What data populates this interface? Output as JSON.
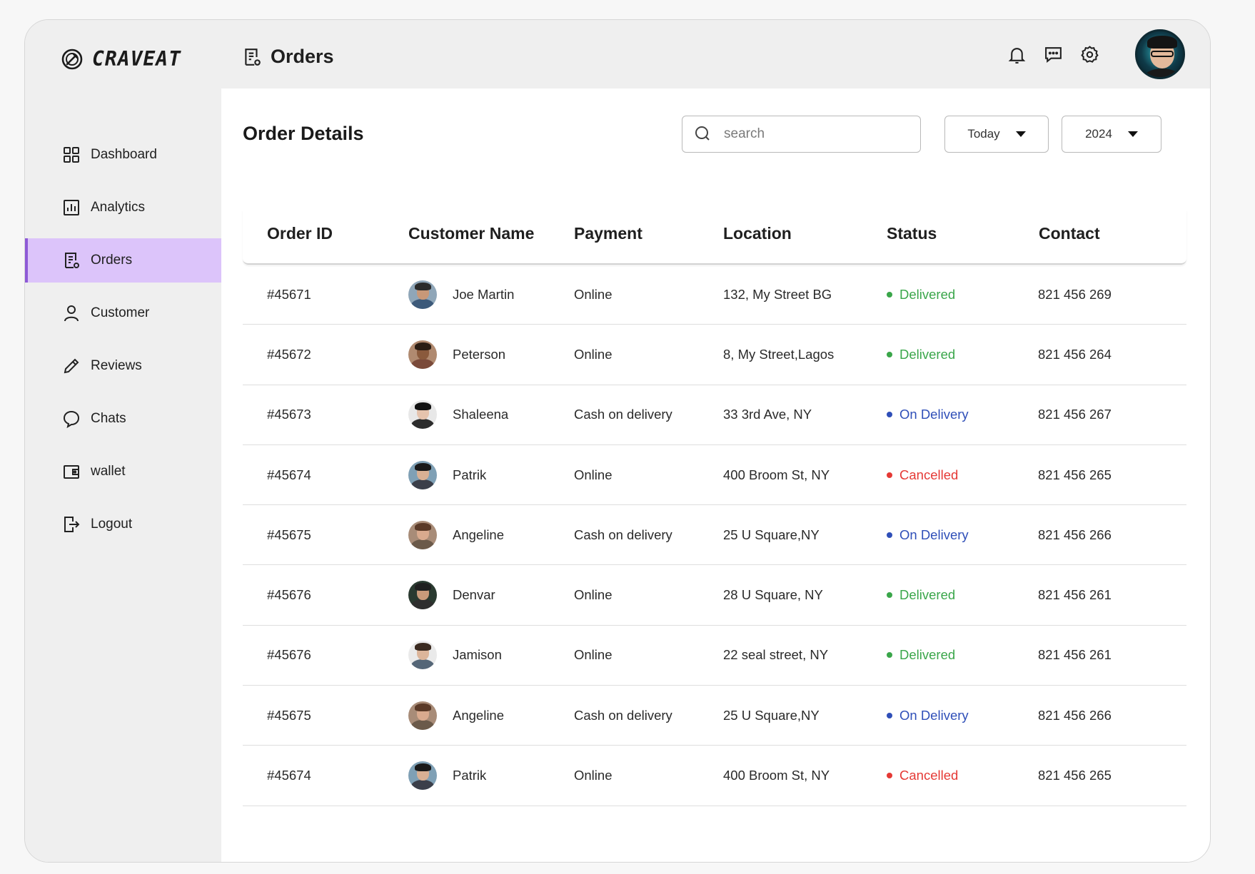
{
  "app": {
    "logo_text": "CRAVEAT"
  },
  "sidebar": {
    "items": [
      {
        "label": "Dashboard",
        "icon": "dashboard-icon"
      },
      {
        "label": "Analytics",
        "icon": "analytics-icon"
      },
      {
        "label": "Orders",
        "icon": "orders-icon",
        "active": true
      },
      {
        "label": "Customer",
        "icon": "customer-icon"
      },
      {
        "label": "Reviews",
        "icon": "pencil-icon"
      },
      {
        "label": "Chats",
        "icon": "chat-bubble-icon"
      },
      {
        "label": "wallet",
        "icon": "wallet-icon"
      },
      {
        "label": "Logout",
        "icon": "logout-icon"
      }
    ]
  },
  "header": {
    "title": "Orders",
    "icons": [
      "bell-icon",
      "message-icon",
      "settings-gear-icon"
    ]
  },
  "main": {
    "section_title": "Order Details",
    "search_placeholder": "search",
    "filter_period": "Today",
    "filter_year": "2024"
  },
  "table": {
    "columns": {
      "id": "Order ID",
      "name": "Customer Name",
      "payment": "Payment",
      "location": "Location",
      "status": "Status",
      "contact": "Contact"
    },
    "rows": [
      {
        "id": "#45671",
        "name": "Joe Martin",
        "payment": "Online",
        "location": "132, My Street BG",
        "status": "Delivered",
        "contact": "821 456 269"
      },
      {
        "id": "#45672",
        "name": "Peterson",
        "payment": "Online",
        "location": "8, My Street,Lagos",
        "status": "Delivered",
        "contact": "821 456 264"
      },
      {
        "id": "#45673",
        "name": "Shaleena",
        "payment": "Cash on delivery",
        "location": "33 3rd Ave, NY",
        "status": "On Delivery",
        "contact": "821 456 267"
      },
      {
        "id": "#45674",
        "name": "Patrik",
        "payment": "Online",
        "location": "400 Broom St, NY",
        "status": "Cancelled",
        "contact": "821 456 265"
      },
      {
        "id": "#45675",
        "name": "Angeline",
        "payment": "Cash on delivery",
        "location": "25 U Square,NY",
        "status": "On Delivery",
        "contact": "821 456 266"
      },
      {
        "id": "#45676",
        "name": "Denvar",
        "payment": "Online",
        "location": "28 U Square, NY",
        "status": "Delivered",
        "contact": "821 456 261"
      },
      {
        "id": "#45676",
        "name": "Jamison",
        "payment": "Online",
        "location": "22 seal street, NY",
        "status": "Delivered",
        "contact": "821 456 261"
      },
      {
        "id": "#45675",
        "name": "Angeline",
        "payment": "Cash on delivery",
        "location": "25 U Square,NY",
        "status": "On Delivery",
        "contact": "821 456 266"
      },
      {
        "id": "#45674",
        "name": "Patrik",
        "payment": "Online",
        "location": "400 Broom St, NY",
        "status": "Cancelled",
        "contact": "821 456 265"
      }
    ]
  },
  "colors": {
    "accent": "#dcc4fa",
    "accent_border": "#8e5ad6",
    "delivered": "#3aa64a",
    "on_delivery": "#2f4fb8",
    "cancelled": "#e53935"
  }
}
